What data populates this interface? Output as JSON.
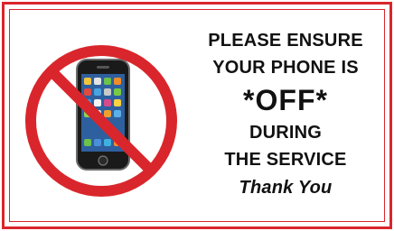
{
  "sign": {
    "lines": [
      "PLEASE ENSURE",
      "YOUR PHONE IS",
      "*OFF*",
      "DURING",
      "THE SERVICE",
      "Thank You"
    ]
  },
  "colors": {
    "accent_red": "#d9262c",
    "text": "#111111"
  },
  "icons": {
    "main_graphic": "no-phone-icon"
  }
}
